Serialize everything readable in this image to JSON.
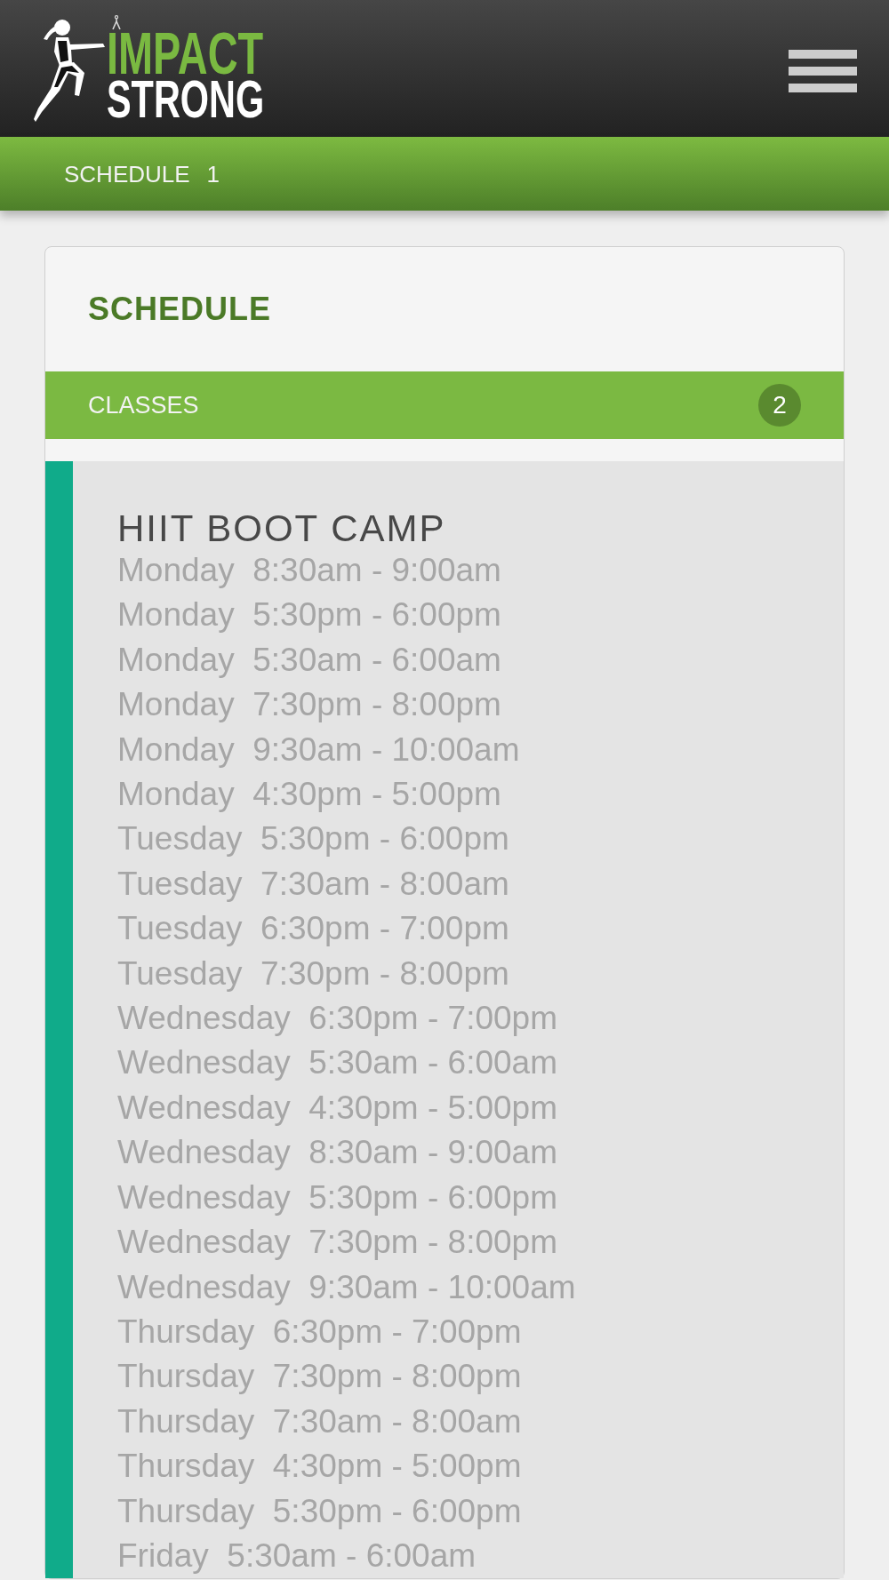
{
  "header": {
    "logo": {
      "line_1": "IMPACT",
      "line_2": "STRONG"
    }
  },
  "breadcrumb": {
    "label": "SCHEDULE",
    "count": "1"
  },
  "panel": {
    "title": "SCHEDULE",
    "section": {
      "label": "CLASSES",
      "count": "2"
    },
    "classes": [
      {
        "name": "HIIT BOOT CAMP",
        "color": "#10ab8a",
        "sessions": [
          "Monday  8:30am - 9:00am",
          "Monday  5:30pm - 6:00pm",
          "Monday  5:30am - 6:00am",
          "Monday  7:30pm - 8:00pm",
          "Monday  9:30am - 10:00am",
          "Monday  4:30pm - 5:00pm",
          "Tuesday  5:30pm - 6:00pm",
          "Tuesday  7:30am - 8:00am",
          "Tuesday  6:30pm - 7:00pm",
          "Tuesday  7:30pm - 8:00pm",
          "Wednesday  6:30pm - 7:00pm",
          "Wednesday  5:30am - 6:00am",
          "Wednesday  4:30pm - 5:00pm",
          "Wednesday  8:30am - 9:00am",
          "Wednesday  5:30pm - 6:00pm",
          "Wednesday  7:30pm - 8:00pm",
          "Wednesday  9:30am - 10:00am",
          "Thursday  6:30pm - 7:00pm",
          "Thursday  7:30pm - 8:00pm",
          "Thursday  7:30am - 8:00am",
          "Thursday  4:30pm - 5:00pm",
          "Thursday  5:30pm - 6:00pm",
          "Friday  5:30am - 6:00am"
        ]
      }
    ]
  }
}
